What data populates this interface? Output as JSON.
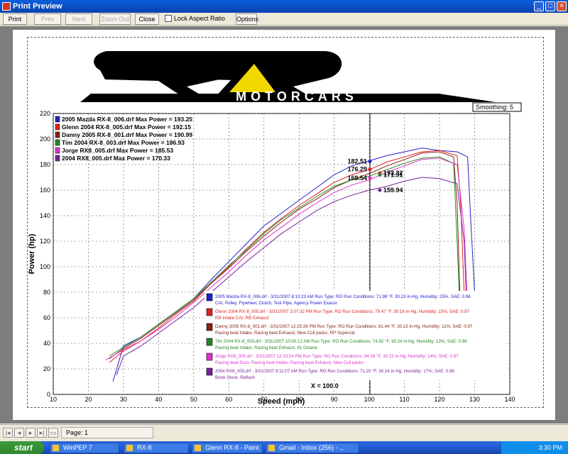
{
  "window": {
    "title": "Print Preview",
    "min": "_",
    "max": "□",
    "close": "×"
  },
  "toolbar": {
    "print": "Print",
    "prev": "Prev",
    "next": "Next",
    "zoom_out": "Zoom Out",
    "close": "Close",
    "lock_aspect": "Lock Aspect Ratio",
    "options": "Options"
  },
  "logo": {
    "text": "MOTORCARS"
  },
  "smoothing": "Smoothing: 5",
  "legend_top": [
    {
      "label": "2005 Mazda RX-8_006.drf Max Power = 193.25",
      "color": "#2222cc"
    },
    {
      "label": "Glenn 2004 RX-8_005.drf Max Power = 192.15",
      "color": "#dd2222"
    },
    {
      "label": "Danny 2005 RX-8_001.drf Max Power = 190.99",
      "color": "#882211"
    },
    {
      "label": "Tim 2004 RX-8_003.drf Max Power = 186.93",
      "color": "#228822"
    },
    {
      "label": "Jorge RX8_005.drf Max Power = 185.53",
      "color": "#dd33cc"
    },
    {
      "label": "2004 RX8_005.drf Max Power = 170.33",
      "color": "#772299"
    }
  ],
  "cursor_values": [
    "182.51",
    "176.29",
    "173.32",
    "169.54",
    "171.91",
    "159.94"
  ],
  "cursor_x_label": "X = 100.0",
  "run_notes": [
    {
      "line1": "2005 Mazda RX-8_006.drf - 3/31/2007 8:13:23 AM  Run Type: RO  Run Conditions: 71.98 °F, 30.23 in-Hg,  Humidity:  25%, SAE: 0.96",
      "line2": "CAI, Pulley, Flywheel, Clutch, Test Pipe, Agency Power Exaust"
    },
    {
      "line1": "Glenn 2004 RX-8_005.drf - 3/31/2007 3:07:32 PM  Run Type: RO  Run Conditions: 79.47 °F, 30.16 in-Hg,  Humidity:  15%, SAE: 0.97",
      "line2": "RB Intake CAI, RB Exhaust"
    },
    {
      "line1": "Danny 2005 RX-8_001.drf - 3/31/2007 12:25:26 PM  Run Type: RO  Run Conditions: 81.44 °F, 30.23 in-Hg,  Humidity:  11%, SAE: 0.97",
      "line2": "Racing beat Intake, Racing beat Exhaust, New Coil packs, RP Supercat"
    },
    {
      "line1": "Tim 2004 RX-8_003.drf - 3/31/2007 10:00:12 AM  Run Type: RO  Run Conditions: 74.82 °F, 30.24 in-Hg,  Humidity:  13%, SAE: 0.96",
      "line2": "Racing beat Intake, Racing beat Exhaust, 91 Octane"
    },
    {
      "line1": "Jorge RX8_005.drf - 3/31/2007 12:10:24 PM  Run Type: RO  Run Conditions: 84.28 °F, 30.23 in-Hg,  Humidity:  14%, SAE: 0.97",
      "line2": "Racing beat Duct, Racing beat Intake, Racing beat Exhaust, New Coil packs"
    },
    {
      "line1": "2004 RX8_005.drf - 3/31/2007 9:11:07 AM  Run Type: RO  Run Conditions: 71.20 °F, 30.24 in-Hg,  Humidity:  17%, SAE: 0.96",
      "line2": "Bone Stock, Reflash"
    }
  ],
  "chart_data": {
    "type": "line",
    "xlabel": "Speed (mph)",
    "ylabel": "Power (hp)",
    "xlim": [
      10,
      140
    ],
    "ylim": [
      0,
      220
    ],
    "xticks": [
      10,
      20,
      30,
      40,
      50,
      60,
      70,
      80,
      90,
      100,
      110,
      120,
      130,
      140
    ],
    "yticks": [
      0,
      20,
      40,
      60,
      80,
      100,
      120,
      140,
      160,
      180,
      200,
      220
    ],
    "grid": true,
    "series": [
      {
        "name": "2005 Mazda RX-8_006.drf Max Power = 193.25",
        "color": "#2222cc",
        "x": [
          27,
          30,
          35,
          40,
          45,
          50,
          55,
          60,
          65,
          70,
          75,
          80,
          85,
          90,
          95,
          100,
          105,
          110,
          115,
          120,
          125,
          128,
          129,
          130
        ],
        "y": [
          10,
          38,
          45,
          55,
          65,
          75,
          90,
          104,
          118,
          132,
          142,
          152,
          162,
          172,
          179,
          183,
          187,
          190,
          193,
          191,
          190,
          186,
          130,
          80
        ]
      },
      {
        "name": "Glenn 2004 RX-8_005.drf Max Power = 192.15",
        "color": "#dd2222",
        "x": [
          26,
          30,
          35,
          40,
          45,
          50,
          55,
          60,
          65,
          70,
          75,
          80,
          85,
          90,
          95,
          100,
          105,
          110,
          115,
          120,
          125,
          126,
          127
        ],
        "y": [
          25,
          34,
          42,
          52,
          63,
          73,
          87,
          100,
          114,
          127,
          138,
          148,
          157,
          166,
          172,
          176,
          182,
          186,
          190,
          191,
          187,
          150,
          80
        ]
      },
      {
        "name": "Danny 2005 RX-8_001.drf Max Power = 190.99",
        "color": "#882211",
        "x": [
          26,
          30,
          35,
          40,
          45,
          50,
          55,
          60,
          65,
          70,
          75,
          80,
          85,
          90,
          95,
          100,
          105,
          110,
          115,
          120,
          124,
          125,
          126
        ],
        "y": [
          28,
          36,
          44,
          54,
          64,
          74,
          87,
          99,
          112,
          124,
          135,
          145,
          153,
          162,
          168,
          173,
          179,
          184,
          189,
          190,
          186,
          150,
          60
        ]
      },
      {
        "name": "Tim 2004 RX-8_003.drf Max Power = 186.93",
        "color": "#228822",
        "x": [
          26,
          30,
          35,
          40,
          45,
          50,
          55,
          60,
          65,
          70,
          75,
          80,
          85,
          90,
          95,
          100,
          105,
          110,
          115,
          120,
          124,
          125,
          126
        ],
        "y": [
          30,
          37,
          45,
          55,
          65,
          75,
          88,
          101,
          113,
          126,
          137,
          146,
          155,
          163,
          168,
          171,
          176,
          181,
          185,
          186,
          181,
          120,
          50
        ]
      },
      {
        "name": "Jorge RX8_005.drf Max Power = 185.53",
        "color": "#dd33cc",
        "x": [
          25,
          30,
          35,
          40,
          45,
          50,
          55,
          60,
          65,
          70,
          75,
          80,
          85,
          90,
          95,
          100,
          105,
          110,
          115,
          120,
          125,
          127,
          128
        ],
        "y": [
          27,
          35,
          42,
          51,
          61,
          72,
          84,
          96,
          109,
          121,
          131,
          141,
          150,
          158,
          164,
          168,
          174,
          179,
          184,
          185,
          180,
          130,
          70
        ]
      },
      {
        "name": "2004 RX8_005.drf Max Power = 170.33",
        "color": "#772299",
        "x": [
          28,
          30,
          35,
          40,
          45,
          50,
          55,
          60,
          65,
          70,
          75,
          80,
          85,
          90,
          95,
          100,
          105,
          110,
          115,
          120,
          125,
          127,
          128
        ],
        "y": [
          15,
          30,
          38,
          48,
          58,
          68,
          80,
          92,
          104,
          115,
          126,
          135,
          144,
          151,
          156,
          160,
          163,
          167,
          170,
          169,
          165,
          120,
          50
        ]
      }
    ]
  },
  "status": {
    "page": "Page: 1"
  },
  "taskbar": {
    "start": "start",
    "tasks": [
      "WinPEP 7",
      "RX-8",
      "Glenn RX-8 - Paint",
      "Gmail - Inbox (256) - ..."
    ],
    "clock": "3:30 PM"
  }
}
